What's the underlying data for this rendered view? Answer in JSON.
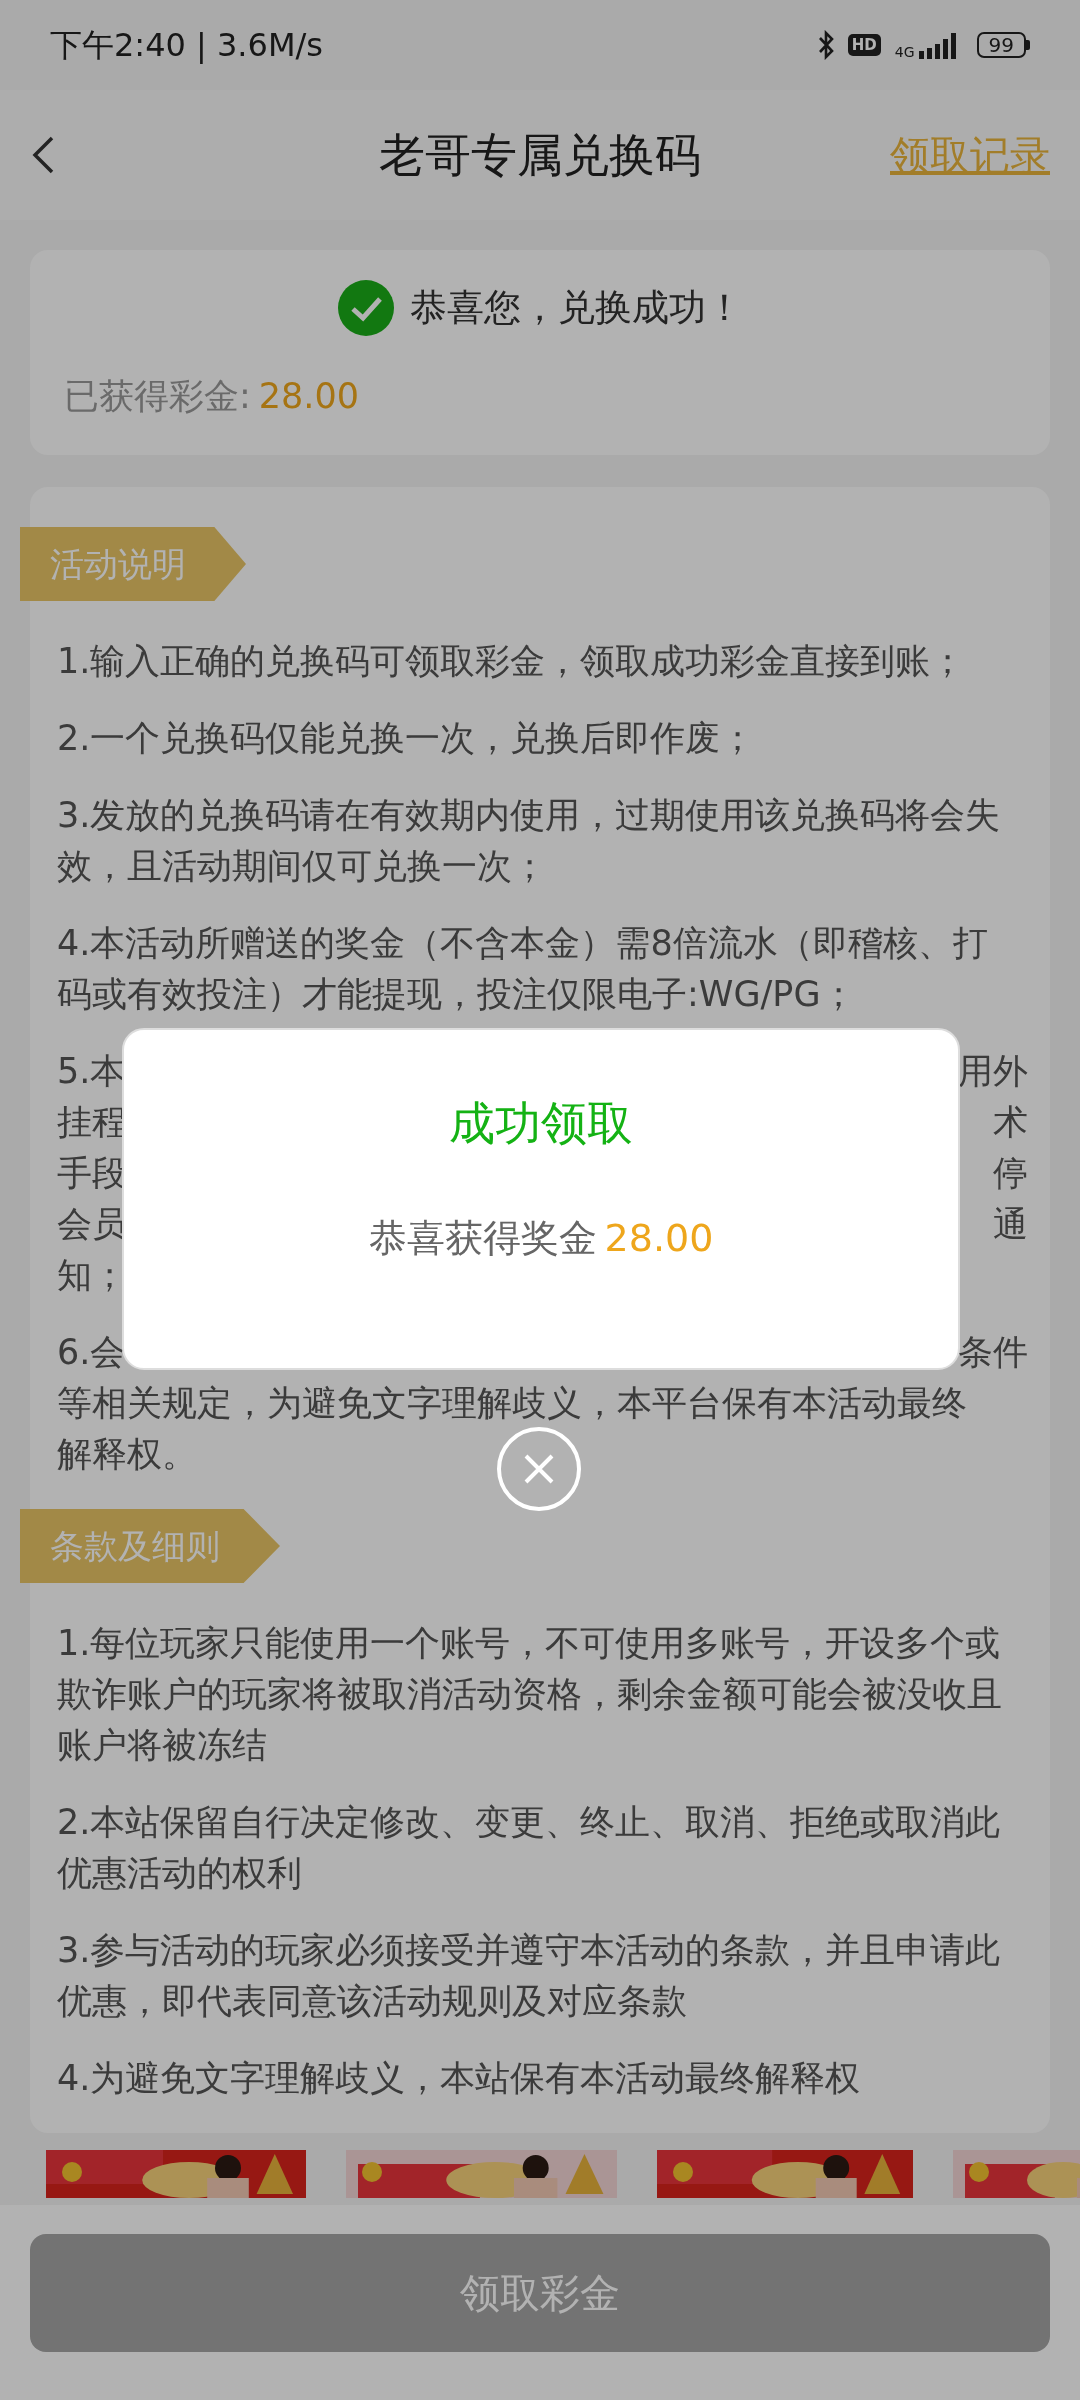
{
  "status_bar": {
    "time": "下午2:40 | 3.6M/s",
    "hd": "HD",
    "network": "4G",
    "battery": "99"
  },
  "header": {
    "title": "老哥专属兑换码",
    "record_link": "领取记录"
  },
  "result_card": {
    "message": "恭喜您，兑换成功！",
    "amount_label": "已获得彩金:",
    "amount": "28.00"
  },
  "sections": [
    {
      "title": "活动说明",
      "items": [
        {
          "kind": "text",
          "text": "1.输入正确的兑换码可领取彩金，领取成功彩金直接到账；"
        },
        {
          "kind": "text",
          "text": "2.一个兑换码仅能兑换一次，兑换后即作废；"
        },
        {
          "kind": "text",
          "text": "3.发放的兑换码请在有效期内使用，过期使用该兑换码将会失效，且活动期间仅可兑换一次；"
        },
        {
          "kind": "text",
          "text": "4.本活动所赠送的奖金（不含本金）需8倍流水（即稽核、打码或有效投注）才能提现，投注仅限电子:WG/PG；"
        },
        {
          "kind": "partial",
          "lines": [
            {
              "start": "5.本",
              "end": "用外"
            },
            {
              "start": "挂程",
              "end": "术"
            },
            {
              "start": "手段",
              "end": "停"
            },
            {
              "start": "会员",
              "end": "通"
            },
            {
              "start": "知；"
            }
          ]
        },
        {
          "kind": "partial",
          "lines": [
            {
              "start": "6.会",
              "end": "条件"
            },
            {
              "start": "等相关规定，为避免文字理解歧义，本平台保有本活动最终"
            },
            {
              "start": "解释权。"
            }
          ]
        }
      ]
    },
    {
      "title": "条款及细则",
      "items": [
        {
          "kind": "text",
          "text": "1.每位玩家只能使用一个账号，不可使用多账号，开设多个或欺诈账户的玩家将被取消活动资格，剩余金额可能会被没收且账户将被冻结"
        },
        {
          "kind": "text",
          "text": "2.本站保留自行决定修改、变更、终止、取消、拒绝或取消此优惠活动的权利"
        },
        {
          "kind": "text",
          "text": "3.参与活动的玩家必须接受并遵守本活动的条款，并且申请此优惠，即代表同意该活动规则及对应条款"
        },
        {
          "kind": "text",
          "text": "4.为避免文字理解歧义，本站保有本活动最终解释权"
        }
      ]
    }
  ],
  "claim_button": {
    "label": "领取彩金",
    "disabled": true
  },
  "modal": {
    "title": "成功领取",
    "message": "恭喜获得奖金",
    "amount": "28.00"
  }
}
